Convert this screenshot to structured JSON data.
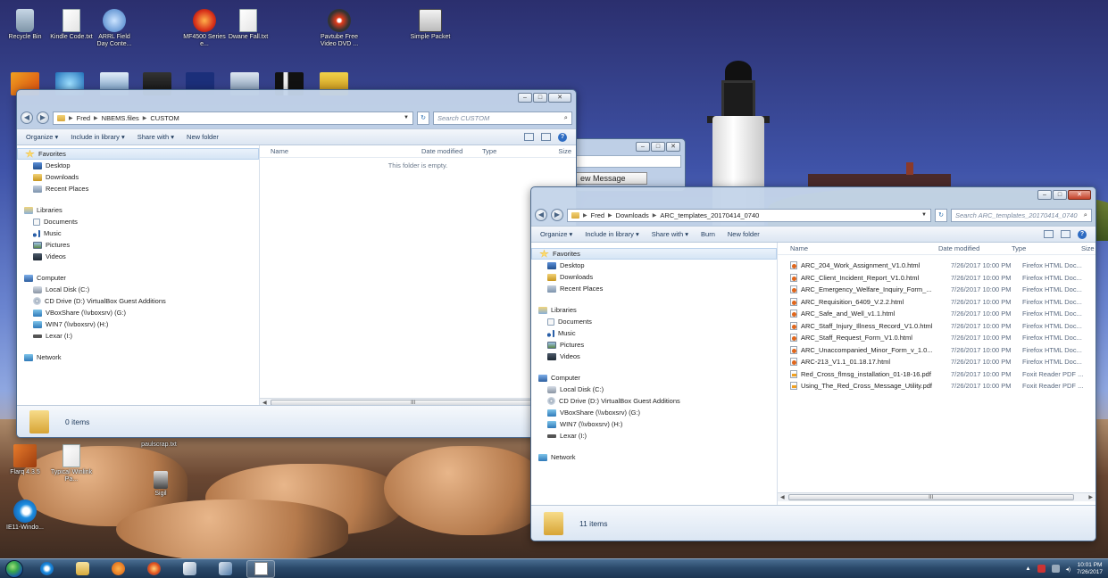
{
  "desktop": {
    "icons": [
      {
        "label": "Recycle Bin",
        "icon": "recycle-bin-icon"
      },
      {
        "label": "Kindle Code.txt",
        "icon": "text-file-icon"
      },
      {
        "label": "ARRL Field Day Conte...",
        "icon": "globe-shortcut-icon"
      },
      {
        "label": "MF4500 Series e...",
        "icon": "firefox-icon"
      },
      {
        "label": "Dwane Fall.txt",
        "icon": "text-file-icon"
      },
      {
        "label": "Pavtube Free Video DVD ...",
        "icon": "dvd-icon"
      },
      {
        "label": "Simple Packet",
        "icon": "packet-icon"
      },
      {
        "label": "paulscrap.txt",
        "icon": "text-file-icon"
      },
      {
        "label": "Flarq 4.3.5",
        "icon": "flarq-icon"
      },
      {
        "label": "Typical Winlink Pa...",
        "icon": "text-file-icon"
      },
      {
        "label": "Sigil",
        "icon": "sigil-icon"
      },
      {
        "label": "IE11-Windo...",
        "icon": "internet-explorer-icon"
      }
    ]
  },
  "bg_window": {
    "new_message": "ew Message"
  },
  "win1": {
    "breadcrumb": [
      "Fred",
      "NBEMS.files",
      "CUSTOM"
    ],
    "search_placeholder": "Search CUSTOM",
    "toolbar": {
      "organize": "Organize ▾",
      "include": "Include in library ▾",
      "share": "Share with ▾",
      "new_folder": "New folder"
    },
    "columns": {
      "name": "Name",
      "date": "Date modified",
      "type": "Type",
      "size": "Size"
    },
    "empty": "This folder is empty.",
    "status": "0 items",
    "scroll": "III"
  },
  "win2": {
    "breadcrumb": [
      "Fred",
      "Downloads",
      "ARC_templates_20170414_0740"
    ],
    "search_placeholder": "Search ARC_templates_20170414_0740",
    "toolbar": {
      "organize": "Organize ▾",
      "include": "Include in library ▾",
      "share": "Share with ▾",
      "burn": "Burn",
      "new_folder": "New folder"
    },
    "columns": {
      "name": "Name",
      "date": "Date modified",
      "type": "Type",
      "size": "Size"
    },
    "files": [
      {
        "name": "ARC_204_Work_Assignment_V1.0.html",
        "date": "7/26/2017 10:00 PM",
        "type": "Firefox HTML Doc...",
        "kind": "html"
      },
      {
        "name": "ARC_Client_Incident_Report_V1.0.html",
        "date": "7/26/2017 10:00 PM",
        "type": "Firefox HTML Doc...",
        "kind": "html"
      },
      {
        "name": "ARC_Emergency_Welfare_Inquiry_Form_...",
        "date": "7/26/2017 10:00 PM",
        "type": "Firefox HTML Doc...",
        "kind": "html"
      },
      {
        "name": "ARC_Requisition_6409_V.2.2.html",
        "date": "7/26/2017 10:00 PM",
        "type": "Firefox HTML Doc...",
        "kind": "html"
      },
      {
        "name": "ARC_Safe_and_Well_v1.1.html",
        "date": "7/26/2017 10:00 PM",
        "type": "Firefox HTML Doc...",
        "kind": "html"
      },
      {
        "name": "ARC_Staff_Injury_Illness_Record_V1.0.html",
        "date": "7/26/2017 10:00 PM",
        "type": "Firefox HTML Doc...",
        "kind": "html"
      },
      {
        "name": "ARC_Staff_Request_Form_V1.0.html",
        "date": "7/26/2017 10:00 PM",
        "type": "Firefox HTML Doc...",
        "kind": "html"
      },
      {
        "name": "ARC_Unaccompanied_Minor_Form_v_1.0...",
        "date": "7/26/2017 10:00 PM",
        "type": "Firefox HTML Doc...",
        "kind": "html"
      },
      {
        "name": "ARC-213_V1.1_01.18.17.html",
        "date": "7/26/2017 10:00 PM",
        "type": "Firefox HTML Doc...",
        "kind": "html"
      },
      {
        "name": "Red_Cross_flmsg_installation_01-18-16.pdf",
        "date": "7/26/2017 10:00 PM",
        "type": "Foxit Reader PDF ...",
        "kind": "pdf"
      },
      {
        "name": "Using_The_Red_Cross_Message_Utility.pdf",
        "date": "7/26/2017 10:00 PM",
        "type": "Foxit Reader PDF ...",
        "kind": "pdf"
      }
    ],
    "status": "11 items",
    "scroll": "III"
  },
  "nav": {
    "favorites": "Favorites",
    "desktop": "Desktop",
    "downloads": "Downloads",
    "recent": "Recent Places",
    "libraries": "Libraries",
    "documents": "Documents",
    "music": "Music",
    "pictures": "Pictures",
    "videos": "Videos",
    "computer": "Computer",
    "local_disk": "Local Disk (C:)",
    "cd_drive": "CD Drive (D:) VirtualBox Guest Additions",
    "vboxshare": "VBoxShare (\\\\vboxsrv) (G:)",
    "win7": "WIN7 (\\\\vboxsrv) (H:)",
    "lexar": "Lexar (I:)",
    "network": "Network"
  },
  "taskbar": {
    "time": "10:01 PM",
    "date": "7/26/2017",
    "items": [
      "internet-explorer-icon",
      "explorer-folder-icon",
      "media-player-icon",
      "firefox-icon",
      "snipping-tool-icon",
      "virtualbox-icon",
      "document-thumbnail-icon"
    ]
  }
}
